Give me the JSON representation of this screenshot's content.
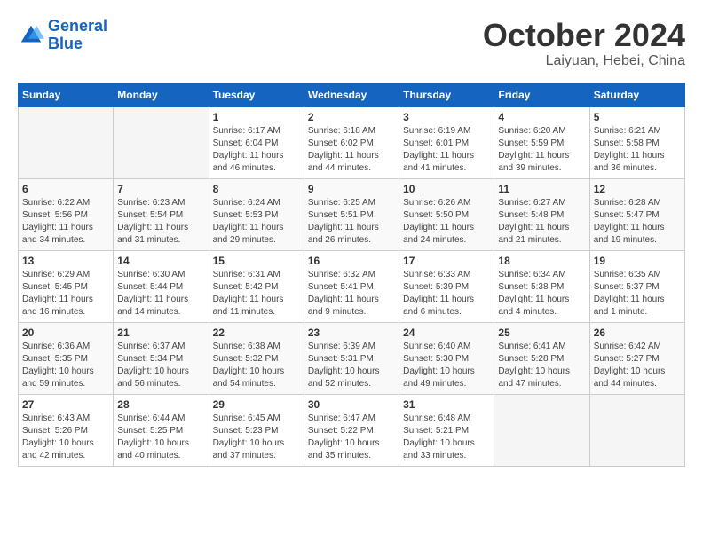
{
  "header": {
    "logo_line1": "General",
    "logo_line2": "Blue",
    "title": "October 2024",
    "subtitle": "Laiyuan, Hebei, China"
  },
  "days_of_week": [
    "Sunday",
    "Monday",
    "Tuesday",
    "Wednesday",
    "Thursday",
    "Friday",
    "Saturday"
  ],
  "weeks": [
    [
      {
        "day": "",
        "content": ""
      },
      {
        "day": "",
        "content": ""
      },
      {
        "day": "1",
        "content": "Sunrise: 6:17 AM\nSunset: 6:04 PM\nDaylight: 11 hours and 46 minutes."
      },
      {
        "day": "2",
        "content": "Sunrise: 6:18 AM\nSunset: 6:02 PM\nDaylight: 11 hours and 44 minutes."
      },
      {
        "day": "3",
        "content": "Sunrise: 6:19 AM\nSunset: 6:01 PM\nDaylight: 11 hours and 41 minutes."
      },
      {
        "day": "4",
        "content": "Sunrise: 6:20 AM\nSunset: 5:59 PM\nDaylight: 11 hours and 39 minutes."
      },
      {
        "day": "5",
        "content": "Sunrise: 6:21 AM\nSunset: 5:58 PM\nDaylight: 11 hours and 36 minutes."
      }
    ],
    [
      {
        "day": "6",
        "content": "Sunrise: 6:22 AM\nSunset: 5:56 PM\nDaylight: 11 hours and 34 minutes."
      },
      {
        "day": "7",
        "content": "Sunrise: 6:23 AM\nSunset: 5:54 PM\nDaylight: 11 hours and 31 minutes."
      },
      {
        "day": "8",
        "content": "Sunrise: 6:24 AM\nSunset: 5:53 PM\nDaylight: 11 hours and 29 minutes."
      },
      {
        "day": "9",
        "content": "Sunrise: 6:25 AM\nSunset: 5:51 PM\nDaylight: 11 hours and 26 minutes."
      },
      {
        "day": "10",
        "content": "Sunrise: 6:26 AM\nSunset: 5:50 PM\nDaylight: 11 hours and 24 minutes."
      },
      {
        "day": "11",
        "content": "Sunrise: 6:27 AM\nSunset: 5:48 PM\nDaylight: 11 hours and 21 minutes."
      },
      {
        "day": "12",
        "content": "Sunrise: 6:28 AM\nSunset: 5:47 PM\nDaylight: 11 hours and 19 minutes."
      }
    ],
    [
      {
        "day": "13",
        "content": "Sunrise: 6:29 AM\nSunset: 5:45 PM\nDaylight: 11 hours and 16 minutes."
      },
      {
        "day": "14",
        "content": "Sunrise: 6:30 AM\nSunset: 5:44 PM\nDaylight: 11 hours and 14 minutes."
      },
      {
        "day": "15",
        "content": "Sunrise: 6:31 AM\nSunset: 5:42 PM\nDaylight: 11 hours and 11 minutes."
      },
      {
        "day": "16",
        "content": "Sunrise: 6:32 AM\nSunset: 5:41 PM\nDaylight: 11 hours and 9 minutes."
      },
      {
        "day": "17",
        "content": "Sunrise: 6:33 AM\nSunset: 5:39 PM\nDaylight: 11 hours and 6 minutes."
      },
      {
        "day": "18",
        "content": "Sunrise: 6:34 AM\nSunset: 5:38 PM\nDaylight: 11 hours and 4 minutes."
      },
      {
        "day": "19",
        "content": "Sunrise: 6:35 AM\nSunset: 5:37 PM\nDaylight: 11 hours and 1 minute."
      }
    ],
    [
      {
        "day": "20",
        "content": "Sunrise: 6:36 AM\nSunset: 5:35 PM\nDaylight: 10 hours and 59 minutes."
      },
      {
        "day": "21",
        "content": "Sunrise: 6:37 AM\nSunset: 5:34 PM\nDaylight: 10 hours and 56 minutes."
      },
      {
        "day": "22",
        "content": "Sunrise: 6:38 AM\nSunset: 5:32 PM\nDaylight: 10 hours and 54 minutes."
      },
      {
        "day": "23",
        "content": "Sunrise: 6:39 AM\nSunset: 5:31 PM\nDaylight: 10 hours and 52 minutes."
      },
      {
        "day": "24",
        "content": "Sunrise: 6:40 AM\nSunset: 5:30 PM\nDaylight: 10 hours and 49 minutes."
      },
      {
        "day": "25",
        "content": "Sunrise: 6:41 AM\nSunset: 5:28 PM\nDaylight: 10 hours and 47 minutes."
      },
      {
        "day": "26",
        "content": "Sunrise: 6:42 AM\nSunset: 5:27 PM\nDaylight: 10 hours and 44 minutes."
      }
    ],
    [
      {
        "day": "27",
        "content": "Sunrise: 6:43 AM\nSunset: 5:26 PM\nDaylight: 10 hours and 42 minutes."
      },
      {
        "day": "28",
        "content": "Sunrise: 6:44 AM\nSunset: 5:25 PM\nDaylight: 10 hours and 40 minutes."
      },
      {
        "day": "29",
        "content": "Sunrise: 6:45 AM\nSunset: 5:23 PM\nDaylight: 10 hours and 37 minutes."
      },
      {
        "day": "30",
        "content": "Sunrise: 6:47 AM\nSunset: 5:22 PM\nDaylight: 10 hours and 35 minutes."
      },
      {
        "day": "31",
        "content": "Sunrise: 6:48 AM\nSunset: 5:21 PM\nDaylight: 10 hours and 33 minutes."
      },
      {
        "day": "",
        "content": ""
      },
      {
        "day": "",
        "content": ""
      }
    ]
  ]
}
